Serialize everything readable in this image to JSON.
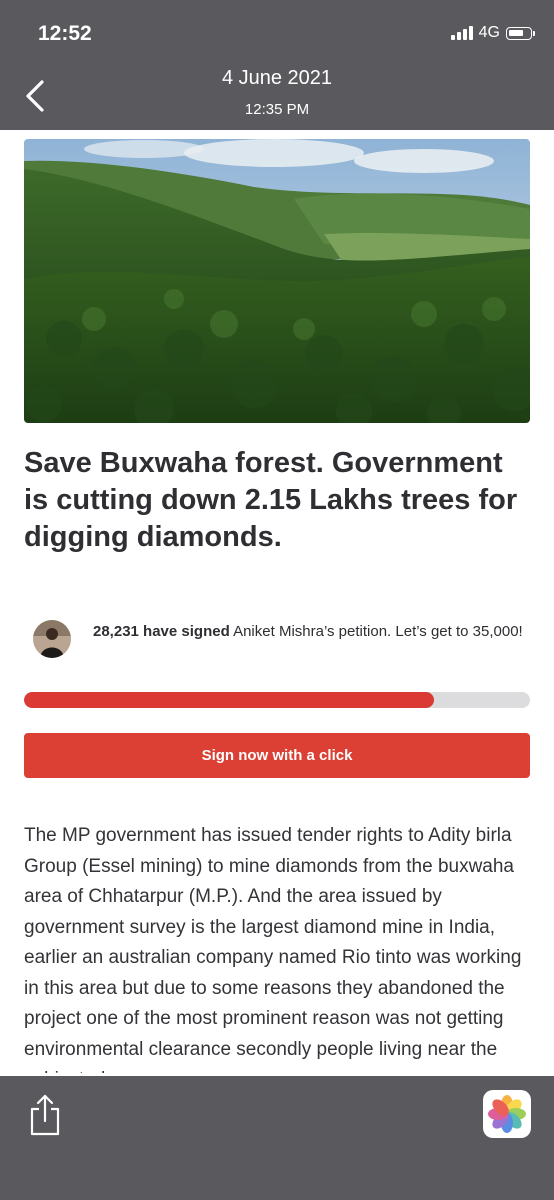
{
  "status_bar": {
    "time": "12:52",
    "network": "4G"
  },
  "header": {
    "date": "4 June 2021",
    "time": "12:35 PM"
  },
  "petition": {
    "title": "Save Buxwaha forest. Government is cutting down 2.15 Lakhs trees for digging diamonds.",
    "signed_count": "28,231 have signed",
    "signed_rest": " Aniket Mishra’s petition. Let’s get to 35,000!",
    "progress_fraction": 0.81,
    "sign_button": "Sign now with a click",
    "body": "The MP government has issued tender rights to Adity birla Group (Essel mining) to mine diamonds from the buxwaha area of Chhatarpur (M.P.). And the area issued by government survey is the largest diamond mine in India, earlier an australian company named Rio tinto was working in this area but due to some reasons they abandoned the project one of the most prominent reason was not getting environmental clearance secondly people living near the subjected area are"
  },
  "colors": {
    "accent": "#dc3f33",
    "bar": "#5a5a5e"
  },
  "icons": {
    "back": "chevron-left-icon",
    "share": "share-icon",
    "photos": "photos-app-icon"
  }
}
